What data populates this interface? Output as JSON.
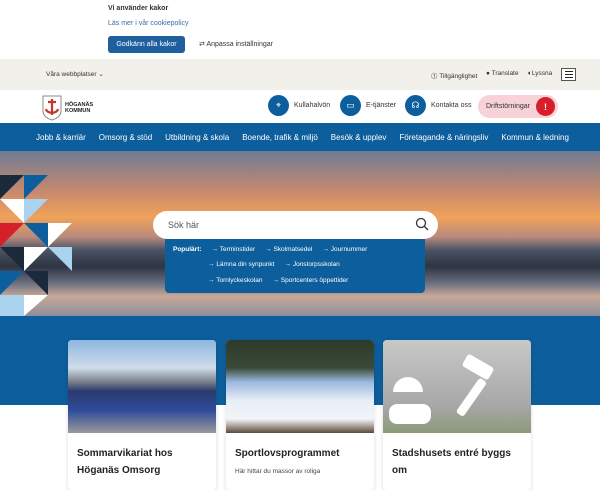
{
  "cookie": {
    "title": "Vi använder kakor",
    "link": "Läs mer i vår cookiepolicy",
    "accept": "Godkänn alla kakor",
    "customize": "Anpassa inställningar"
  },
  "topbar": {
    "sites": "Våra webbplatser",
    "accessibility": "Tillgänglighet",
    "translate": "Translate",
    "listen": "Lyssna"
  },
  "header": {
    "logo_text": "HÖGANÄS KOMMUN",
    "buttons": [
      {
        "label": "Kullahalvön"
      },
      {
        "label": "E-tjänster"
      },
      {
        "label": "Kontakta oss"
      }
    ],
    "alert": "Driftstörningar"
  },
  "nav": [
    "Jobb & karriär",
    "Omsorg & stöd",
    "Utbildning & skola",
    "Boende, trafik & miljö",
    "Besök & upplev",
    "Företagande & näringsliv",
    "Kommun & ledning"
  ],
  "search": {
    "placeholder": "Sök här",
    "popular_label": "Populärt:",
    "links": [
      "Terminstider",
      "Skolmatsedel",
      "Journummer",
      "Lämna din synpunkt",
      "Jonstorpsskolan",
      "Tornlyckeskolan",
      "Sportcenters öppettider"
    ]
  },
  "cards": [
    {
      "title": "Sommarvikariat hos Höganäs Omsorg",
      "text": ""
    },
    {
      "title": "Sportlovsprogrammet",
      "text": "Här hittar du massor av roliga"
    },
    {
      "title": "Stadshusets entré byggs om",
      "text": ""
    }
  ]
}
